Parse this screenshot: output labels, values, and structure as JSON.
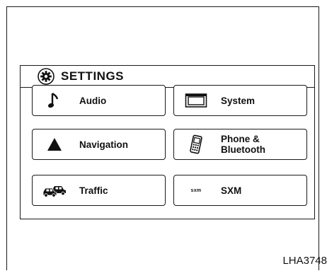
{
  "header": {
    "title": "SETTINGS",
    "icon": "gear-icon"
  },
  "buttons": {
    "audio": {
      "label": "Audio",
      "icon": "music-note-icon"
    },
    "system": {
      "label": "System",
      "icon": "display-icon"
    },
    "navigation": {
      "label": "Navigation",
      "icon": "triangle-arrow-icon"
    },
    "phone": {
      "label_line1": "Phone &",
      "label_line2": "Bluetooth",
      "icon": "cell-phone-icon"
    },
    "traffic": {
      "label": "Traffic",
      "icon": "cars-icon"
    },
    "sxm": {
      "label": "SXM",
      "icon_text": "sxm"
    }
  },
  "caption": "LHA3748"
}
